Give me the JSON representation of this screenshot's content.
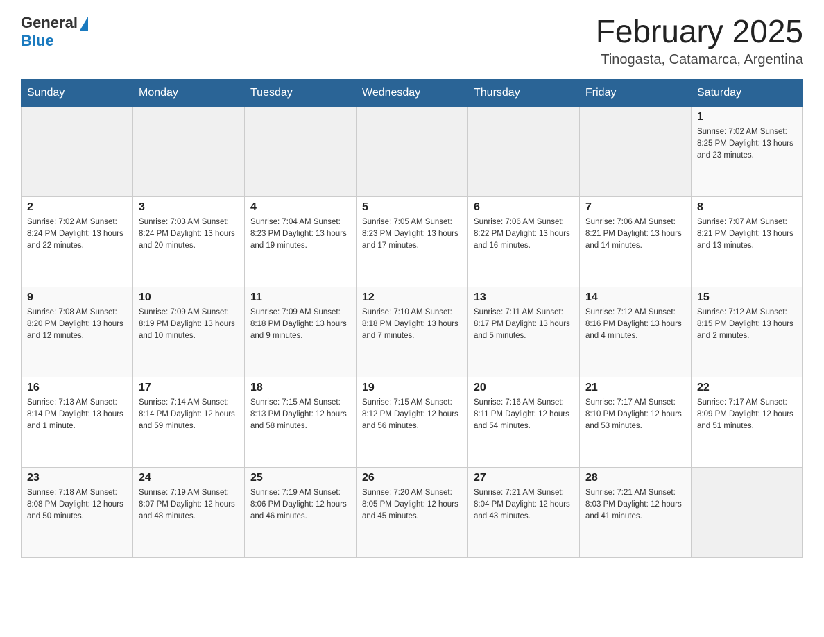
{
  "header": {
    "logo_general": "General",
    "logo_blue": "Blue",
    "title": "February 2025",
    "subtitle": "Tinogasta, Catamarca, Argentina"
  },
  "days_of_week": [
    "Sunday",
    "Monday",
    "Tuesday",
    "Wednesday",
    "Thursday",
    "Friday",
    "Saturday"
  ],
  "weeks": [
    [
      {
        "day": "",
        "info": ""
      },
      {
        "day": "",
        "info": ""
      },
      {
        "day": "",
        "info": ""
      },
      {
        "day": "",
        "info": ""
      },
      {
        "day": "",
        "info": ""
      },
      {
        "day": "",
        "info": ""
      },
      {
        "day": "1",
        "info": "Sunrise: 7:02 AM\nSunset: 8:25 PM\nDaylight: 13 hours and 23 minutes."
      }
    ],
    [
      {
        "day": "2",
        "info": "Sunrise: 7:02 AM\nSunset: 8:24 PM\nDaylight: 13 hours and 22 minutes."
      },
      {
        "day": "3",
        "info": "Sunrise: 7:03 AM\nSunset: 8:24 PM\nDaylight: 13 hours and 20 minutes."
      },
      {
        "day": "4",
        "info": "Sunrise: 7:04 AM\nSunset: 8:23 PM\nDaylight: 13 hours and 19 minutes."
      },
      {
        "day": "5",
        "info": "Sunrise: 7:05 AM\nSunset: 8:23 PM\nDaylight: 13 hours and 17 minutes."
      },
      {
        "day": "6",
        "info": "Sunrise: 7:06 AM\nSunset: 8:22 PM\nDaylight: 13 hours and 16 minutes."
      },
      {
        "day": "7",
        "info": "Sunrise: 7:06 AM\nSunset: 8:21 PM\nDaylight: 13 hours and 14 minutes."
      },
      {
        "day": "8",
        "info": "Sunrise: 7:07 AM\nSunset: 8:21 PM\nDaylight: 13 hours and 13 minutes."
      }
    ],
    [
      {
        "day": "9",
        "info": "Sunrise: 7:08 AM\nSunset: 8:20 PM\nDaylight: 13 hours and 12 minutes."
      },
      {
        "day": "10",
        "info": "Sunrise: 7:09 AM\nSunset: 8:19 PM\nDaylight: 13 hours and 10 minutes."
      },
      {
        "day": "11",
        "info": "Sunrise: 7:09 AM\nSunset: 8:18 PM\nDaylight: 13 hours and 9 minutes."
      },
      {
        "day": "12",
        "info": "Sunrise: 7:10 AM\nSunset: 8:18 PM\nDaylight: 13 hours and 7 minutes."
      },
      {
        "day": "13",
        "info": "Sunrise: 7:11 AM\nSunset: 8:17 PM\nDaylight: 13 hours and 5 minutes."
      },
      {
        "day": "14",
        "info": "Sunrise: 7:12 AM\nSunset: 8:16 PM\nDaylight: 13 hours and 4 minutes."
      },
      {
        "day": "15",
        "info": "Sunrise: 7:12 AM\nSunset: 8:15 PM\nDaylight: 13 hours and 2 minutes."
      }
    ],
    [
      {
        "day": "16",
        "info": "Sunrise: 7:13 AM\nSunset: 8:14 PM\nDaylight: 13 hours and 1 minute."
      },
      {
        "day": "17",
        "info": "Sunrise: 7:14 AM\nSunset: 8:14 PM\nDaylight: 12 hours and 59 minutes."
      },
      {
        "day": "18",
        "info": "Sunrise: 7:15 AM\nSunset: 8:13 PM\nDaylight: 12 hours and 58 minutes."
      },
      {
        "day": "19",
        "info": "Sunrise: 7:15 AM\nSunset: 8:12 PM\nDaylight: 12 hours and 56 minutes."
      },
      {
        "day": "20",
        "info": "Sunrise: 7:16 AM\nSunset: 8:11 PM\nDaylight: 12 hours and 54 minutes."
      },
      {
        "day": "21",
        "info": "Sunrise: 7:17 AM\nSunset: 8:10 PM\nDaylight: 12 hours and 53 minutes."
      },
      {
        "day": "22",
        "info": "Sunrise: 7:17 AM\nSunset: 8:09 PM\nDaylight: 12 hours and 51 minutes."
      }
    ],
    [
      {
        "day": "23",
        "info": "Sunrise: 7:18 AM\nSunset: 8:08 PM\nDaylight: 12 hours and 50 minutes."
      },
      {
        "day": "24",
        "info": "Sunrise: 7:19 AM\nSunset: 8:07 PM\nDaylight: 12 hours and 48 minutes."
      },
      {
        "day": "25",
        "info": "Sunrise: 7:19 AM\nSunset: 8:06 PM\nDaylight: 12 hours and 46 minutes."
      },
      {
        "day": "26",
        "info": "Sunrise: 7:20 AM\nSunset: 8:05 PM\nDaylight: 12 hours and 45 minutes."
      },
      {
        "day": "27",
        "info": "Sunrise: 7:21 AM\nSunset: 8:04 PM\nDaylight: 12 hours and 43 minutes."
      },
      {
        "day": "28",
        "info": "Sunrise: 7:21 AM\nSunset: 8:03 PM\nDaylight: 12 hours and 41 minutes."
      },
      {
        "day": "",
        "info": ""
      }
    ]
  ]
}
